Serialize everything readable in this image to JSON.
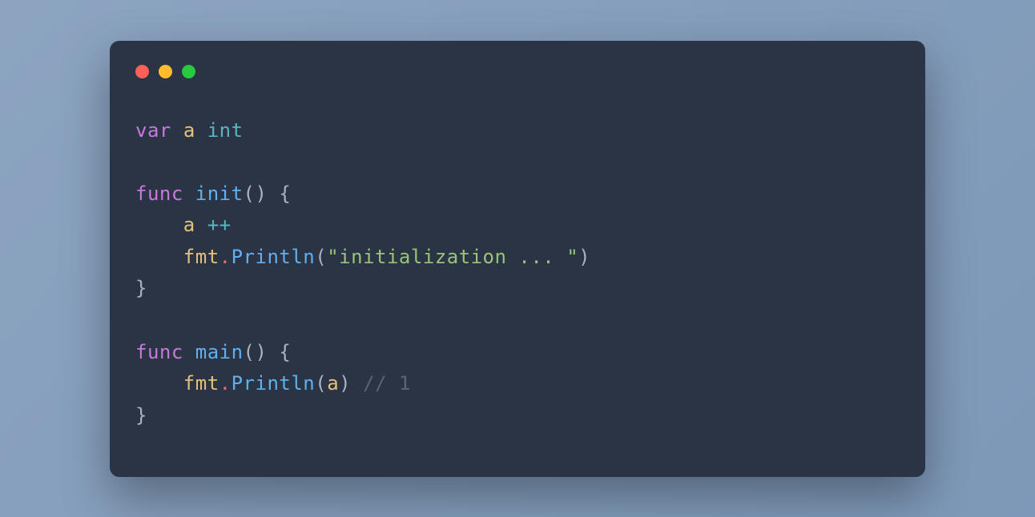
{
  "colors": {
    "background": "#8ca4c0",
    "window": "#2b3444",
    "red": "#ff5f56",
    "yellow": "#ffbd2e",
    "green": "#27c93f"
  },
  "code": {
    "l1": {
      "var": "var",
      "a": "a",
      "int": "int"
    },
    "l3": {
      "func": "func",
      "init": "init",
      "parens": "()",
      "brace": " {"
    },
    "l4": {
      "indent": "    ",
      "a": "a",
      "op": " ++"
    },
    "l5": {
      "indent": "    ",
      "fmt": "fmt",
      "dot": ".",
      "fn": "Println",
      "lp": "(",
      "str": "\"initialization ... \"",
      "rp": ")"
    },
    "l6": {
      "brace": "}"
    },
    "l8": {
      "func": "func",
      "main": "main",
      "parens": "()",
      "brace": " {"
    },
    "l9": {
      "indent": "    ",
      "fmt": "fmt",
      "dot": ".",
      "fn": "Println",
      "lp": "(",
      "a": "a",
      "rp": ")",
      "comment": " // 1"
    },
    "l10": {
      "brace": "}"
    }
  }
}
